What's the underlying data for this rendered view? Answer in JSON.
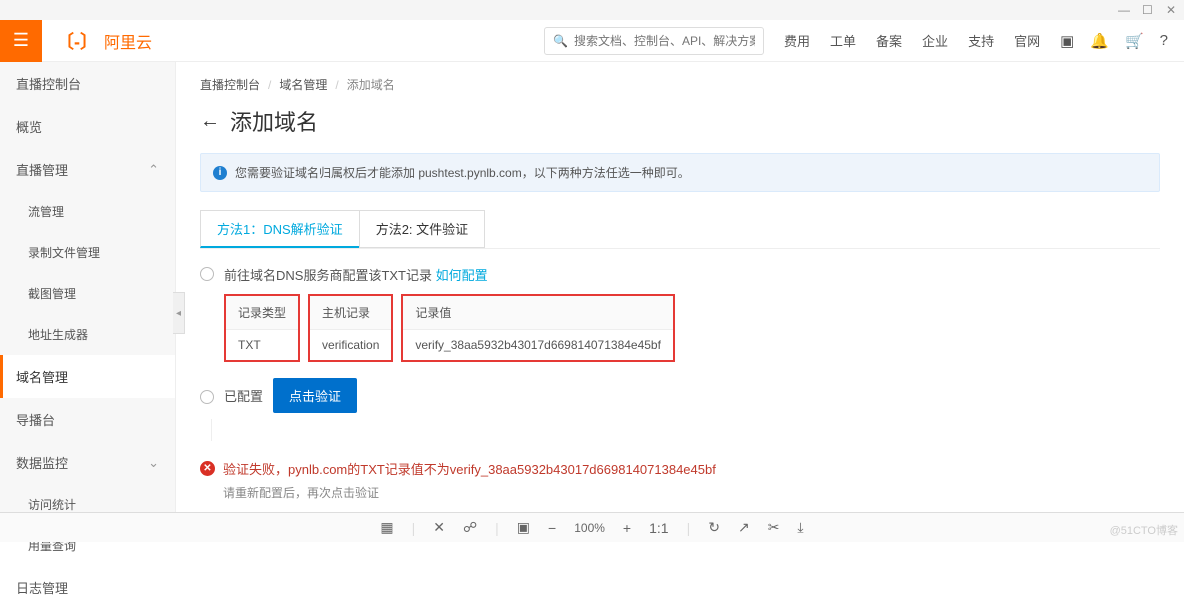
{
  "window": {
    "min": "—",
    "max": "☐",
    "close": "✕"
  },
  "brand": {
    "icon": "〔-〕",
    "name": "阿里云"
  },
  "search": {
    "placeholder": "搜索文档、控制台、API、解决方案和资源"
  },
  "topnav": [
    "费用",
    "工单",
    "备案",
    "企业",
    "支持",
    "官网"
  ],
  "sidebar": {
    "items": [
      {
        "label": "直播控制台",
        "type": "item"
      },
      {
        "label": "概览",
        "type": "item"
      },
      {
        "label": "直播管理",
        "type": "group",
        "open": true
      },
      {
        "label": "流管理",
        "type": "sub"
      },
      {
        "label": "录制文件管理",
        "type": "sub"
      },
      {
        "label": "截图管理",
        "type": "sub"
      },
      {
        "label": "地址生成器",
        "type": "sub"
      },
      {
        "label": "域名管理",
        "type": "item",
        "active": true
      },
      {
        "label": "导播台",
        "type": "item"
      },
      {
        "label": "数据监控",
        "type": "group",
        "open": false
      },
      {
        "label": "访问统计",
        "type": "sub"
      },
      {
        "label": "用量查询",
        "type": "sub"
      },
      {
        "label": "日志管理",
        "type": "item"
      }
    ]
  },
  "breadcrumb": [
    "直播控制台",
    "域名管理",
    "添加域名"
  ],
  "page_title": "添加域名",
  "infobox": "您需要验证域名归属权后才能添加 pushtest.pynlb.com，以下两种方法任选一种即可。",
  "tabs": {
    "t1": "方法1：DNS解析验证",
    "t2": "方法2: 文件验证"
  },
  "step1": {
    "text": "前往域名DNS服务商配置该TXT记录 ",
    "link": "如何配置"
  },
  "dns": {
    "header": {
      "type": "记录类型",
      "host": "主机记录",
      "value": "记录值"
    },
    "row": {
      "type": "TXT",
      "host": "verification",
      "value": "verify_38aa5932b43017d669814071384e45bf"
    }
  },
  "step2": {
    "text": "已配置",
    "button": "点击验证"
  },
  "error": {
    "msg": "验证失败，pynlb.com的TXT记录值不为verify_38aa5932b43017d669814071384e45bf",
    "sub": "请重新配置后，再次点击验证"
  },
  "bottombar": {
    "zoom": "100%"
  },
  "watermark": "@51CTO博客"
}
